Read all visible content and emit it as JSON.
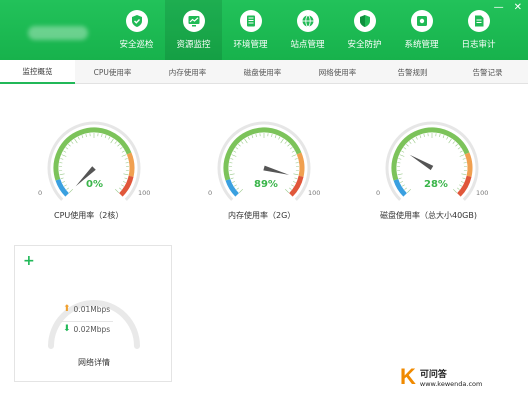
{
  "window": {
    "minimize": "—",
    "close": "✕"
  },
  "nav": [
    {
      "label": "安全巡检",
      "icon": "shield-check-icon"
    },
    {
      "label": "资源监控",
      "icon": "monitor-chart-icon",
      "active": true
    },
    {
      "label": "环境管理",
      "icon": "server-icon"
    },
    {
      "label": "站点管理",
      "icon": "globe-icon"
    },
    {
      "label": "安全防护",
      "icon": "shield-icon"
    },
    {
      "label": "系统管理",
      "icon": "gear-icon"
    },
    {
      "label": "日志审计",
      "icon": "document-icon"
    }
  ],
  "tabs": [
    "监控概览",
    "CPU使用率",
    "内存使用率",
    "磁盘使用率",
    "网络使用率",
    "告警规则",
    "告警记录"
  ],
  "gauges": [
    {
      "caption": "CPU使用率（2核）",
      "value": 0,
      "display": "0%",
      "min": "0",
      "max": "100"
    },
    {
      "caption": "内存使用率（2G）",
      "value": 89,
      "display": "89%",
      "min": "0",
      "max": "100"
    },
    {
      "caption": "磁盘使用率（总大小40GB)",
      "value": 28,
      "display": "28%",
      "min": "0",
      "max": "100"
    }
  ],
  "network": {
    "plus": "+",
    "upload": "0.01Mbps",
    "download": "0.02Mbps",
    "caption": "网络详情"
  },
  "watermark": {
    "mark": "K",
    "title": "可问答",
    "url": "www.kewenda.com"
  },
  "colors": {
    "brand": "#1fba55",
    "gauge_green": "#7cc35a",
    "gauge_orange": "#f0a050",
    "gauge_red": "#e0573a",
    "gauge_blue": "#3aa0e0",
    "value_text": "#3ab54a"
  }
}
